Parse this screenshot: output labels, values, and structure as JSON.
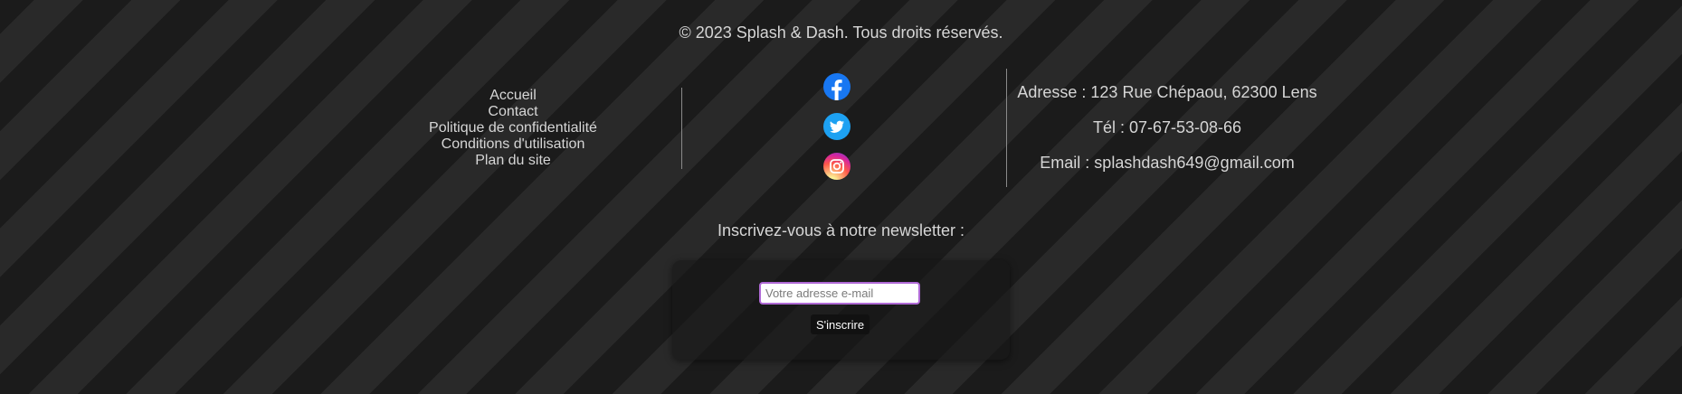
{
  "footer": {
    "copyright": "© 2023 Splash & Dash. Tous droits réservés.",
    "nav_links": [
      {
        "label": "Accueil"
      },
      {
        "label": "Contact"
      },
      {
        "label": "Politique de confidentialité"
      },
      {
        "label": "Conditions d'utilisation"
      },
      {
        "label": "Plan du site"
      }
    ],
    "social": [
      {
        "name": "facebook-icon",
        "color": "#1877f2"
      },
      {
        "name": "twitter-icon",
        "color": "#1da1f2"
      },
      {
        "name": "instagram-icon",
        "color": "#e1306c"
      }
    ],
    "contact": {
      "address": "Adresse : 123 Rue Chépaou, 62300 Lens",
      "phone": "Tél : 07-67-53-08-66",
      "email": "Email : splashdash649@gmail.com"
    },
    "newsletter": {
      "title": "Inscrivez-vous à notre newsletter :",
      "email_placeholder": "Votre adresse e-mail",
      "email_value": "",
      "subscribe_label": "S'inscrire"
    }
  },
  "colors": {
    "background_dark": "#1b1b1b",
    "background_stripe": "#292929",
    "text": "#d6d6d6",
    "input_border": "#b06ad6"
  }
}
